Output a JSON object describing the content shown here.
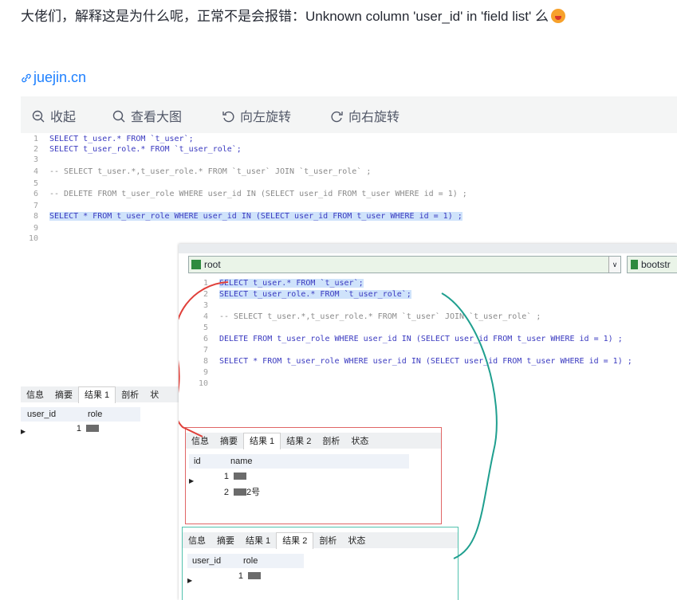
{
  "question": "大佬们，解释这是为什么呢，正常不是会报错：Unknown column 'user_id' in 'field list' 么",
  "link_text": "juejin.cn",
  "toolbar": {
    "collapse": "收起",
    "view_large": "查看大图",
    "rotate_left": "向左旋转",
    "rotate_right": "向右旋转"
  },
  "editor1": {
    "line_numbers": [
      "1",
      "2",
      "3",
      "4",
      "5",
      "6",
      "7",
      "8",
      "9",
      "10"
    ],
    "lines": [
      "SELECT t_user.* FROM `t_user`;",
      "SELECT t_user_role.* FROM `t_user_role`;",
      "",
      "-- SELECT t_user.*,t_user_role.* FROM `t_user` JOIN `t_user_role` ;",
      "",
      "-- DELETE FROM t_user_role WHERE user_id IN (SELECT user_id FROM t_user WHERE id = 1) ;",
      "",
      "SELECT * FROM t_user_role WHERE user_id IN (SELECT user_id FROM t_user WHERE id = 1) ;",
      "",
      ""
    ]
  },
  "result_tabs_left": [
    "信息",
    "摘要",
    "结果 1",
    "剖析",
    "状"
  ],
  "left_grid": {
    "headers": [
      "user_id",
      "role"
    ],
    "rows": [
      [
        "1"
      ]
    ]
  },
  "popup": {
    "db_combo": "root",
    "db_combo2": "bootstr",
    "editor": {
      "line_numbers": [
        "1",
        "2",
        "3",
        "4",
        "5",
        "6",
        "7",
        "8",
        "9",
        "10"
      ],
      "lines": [
        "SELECT t_user.* FROM `t_user`;",
        "SELECT t_user_role.* FROM `t_user_role`;",
        "",
        "-- SELECT t_user.*,t_user_role.* FROM `t_user` JOIN `t_user_role` ;",
        "",
        "DELETE FROM t_user_role WHERE user_id IN (SELECT user_id FROM t_user WHERE id = 1) ;",
        "",
        "SELECT * FROM t_user_role WHERE user_id IN (SELECT user_id FROM t_user WHERE id = 1) ;",
        "",
        ""
      ]
    },
    "tabs": [
      "信息",
      "摘要",
      "结果 1",
      "结果 2",
      "剖析",
      "状态"
    ],
    "result1": {
      "headers": [
        "id",
        "name"
      ],
      "rows": [
        [
          "1",
          ""
        ],
        [
          "2",
          "2号"
        ]
      ]
    },
    "result2": {
      "headers": [
        "user_id",
        "role"
      ],
      "rows": [
        [
          "1"
        ]
      ]
    }
  },
  "colors": {
    "link": "#1e80ff",
    "red_annotation": "#e0403a",
    "teal_annotation": "#1f9f8f"
  }
}
